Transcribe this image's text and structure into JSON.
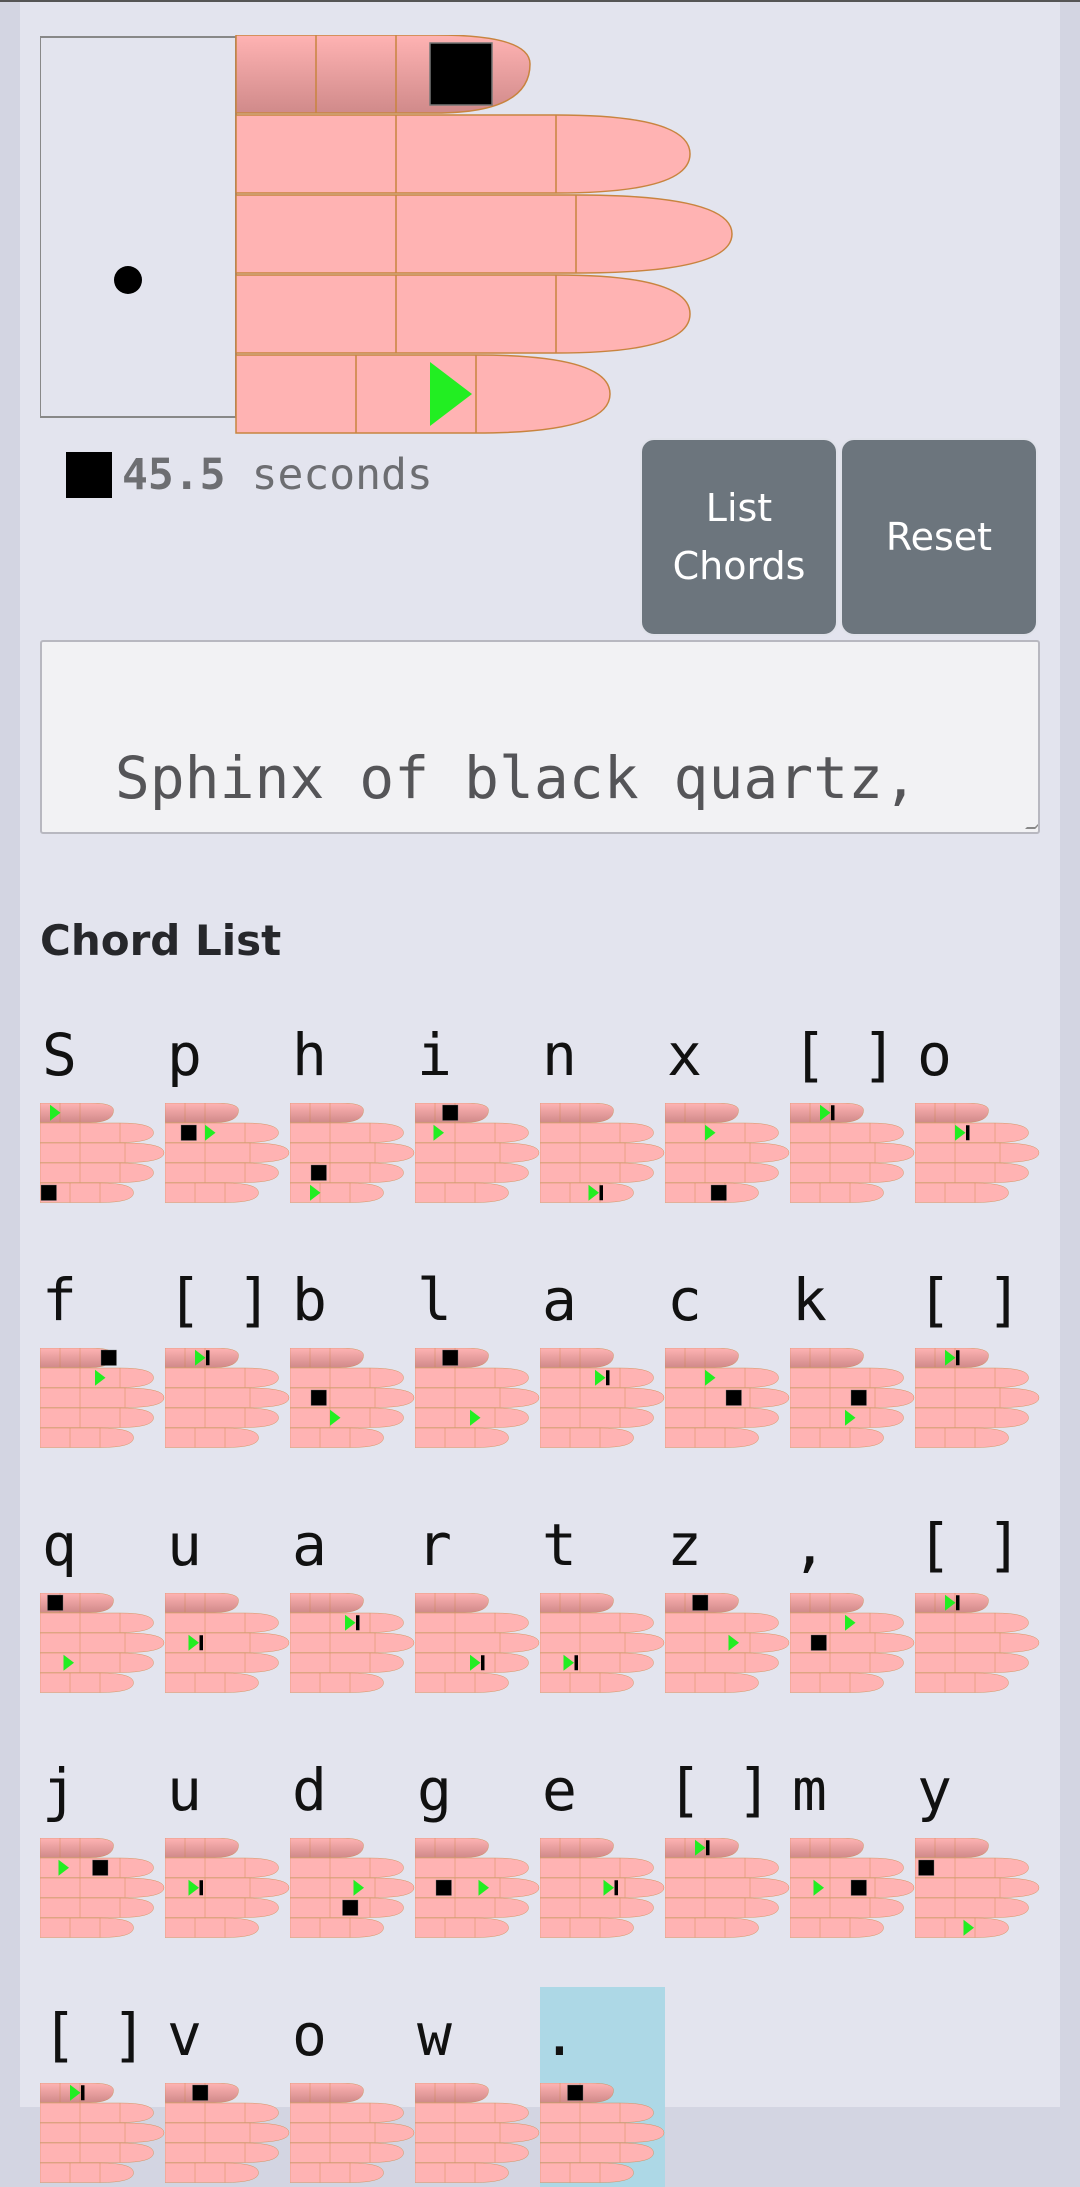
{
  "timer": {
    "value": "45.5",
    "unit": "seconds"
  },
  "buttons": {
    "list_chords": "List Chords",
    "reset": "Reset"
  },
  "text": "Sphinx of black quartz, judge my vow.",
  "chord_list_title": "Chord List",
  "colors": {
    "skin": "#ffb3b3",
    "skin_top": "#d08a8a",
    "outline": "#c8843f",
    "press_square": "#000000",
    "press_arrow": "#22ee22",
    "highlight": "#add8e6"
  },
  "big_hand": {
    "square": [
      "thumb",
      3
    ],
    "arrow": [
      "pinky",
      3
    ],
    "bar": false,
    "palm_dot": true
  },
  "chords": [
    {
      "char": "S",
      "square": [
        "pinky",
        1
      ],
      "arrow": [
        "thumb",
        1
      ]
    },
    {
      "char": "p",
      "square": [
        "index",
        2
      ],
      "arrow": [
        "index",
        3
      ]
    },
    {
      "char": "h",
      "square": [
        "ring",
        2
      ],
      "arrow": [
        "pinky",
        2
      ]
    },
    {
      "char": "i",
      "square": [
        "thumb",
        2
      ],
      "arrow": [
        "index",
        2
      ]
    },
    {
      "char": "n",
      "square": null,
      "arrow": [
        "pinky",
        3
      ],
      "bar": true
    },
    {
      "char": "x",
      "square": [
        "pinky",
        3
      ],
      "arrow": [
        "index",
        3
      ]
    },
    {
      "char": "[ ]",
      "square": null,
      "arrow": [
        "thumb",
        2
      ],
      "bar": true
    },
    {
      "char": "o",
      "square": null,
      "arrow": [
        "index",
        3
      ],
      "bar": true
    },
    {
      "char": "f",
      "square": [
        "thumb",
        4
      ],
      "arrow": [
        "index",
        4
      ]
    },
    {
      "char": "[ ]",
      "square": null,
      "arrow": [
        "thumb",
        2
      ],
      "bar": true
    },
    {
      "char": "b",
      "square": [
        "middle",
        2
      ],
      "arrow": [
        "ring",
        3
      ]
    },
    {
      "char": "l",
      "square": [
        "thumb",
        2
      ],
      "arrow": [
        "ring",
        4
      ]
    },
    {
      "char": "a",
      "square": null,
      "arrow": [
        "index",
        4
      ],
      "bar": true
    },
    {
      "char": "c",
      "square": [
        "middle",
        4
      ],
      "arrow": [
        "index",
        3
      ]
    },
    {
      "char": "k",
      "square": [
        "middle",
        4
      ],
      "arrow": [
        "ring",
        4
      ]
    },
    {
      "char": "[ ]",
      "square": null,
      "arrow": [
        "thumb",
        2
      ],
      "bar": true
    },
    {
      "char": "q",
      "square": [
        "thumb",
        1
      ],
      "arrow": [
        "ring",
        2
      ]
    },
    {
      "char": "u",
      "square": null,
      "arrow": [
        "middle",
        2
      ],
      "bar": true
    },
    {
      "char": "a",
      "square": null,
      "arrow": [
        "index",
        4
      ],
      "bar": true
    },
    {
      "char": "r",
      "square": null,
      "arrow": [
        "ring",
        4
      ],
      "bar": true
    },
    {
      "char": "t",
      "square": null,
      "arrow": [
        "ring",
        2
      ],
      "bar": true
    },
    {
      "char": "z",
      "square": [
        "thumb",
        2
      ],
      "arrow": [
        "middle",
        4
      ]
    },
    {
      "char": ",",
      "square": [
        "middle",
        2
      ],
      "arrow": [
        "index",
        4
      ]
    },
    {
      "char": "[ ]",
      "square": null,
      "arrow": [
        "thumb",
        2
      ],
      "bar": true
    },
    {
      "char": "j",
      "square": [
        "index",
        4
      ],
      "arrow": [
        "index",
        2
      ]
    },
    {
      "char": "u",
      "square": null,
      "arrow": [
        "middle",
        2
      ],
      "bar": true
    },
    {
      "char": "d",
      "square": [
        "ring",
        4
      ],
      "arrow": [
        "middle",
        4
      ]
    },
    {
      "char": "g",
      "square": [
        "middle",
        2
      ],
      "arrow": [
        "middle",
        4
      ]
    },
    {
      "char": "e",
      "square": null,
      "arrow": [
        "middle",
        4
      ],
      "bar": true
    },
    {
      "char": "[ ]",
      "square": null,
      "arrow": [
        "thumb",
        2
      ],
      "bar": true
    },
    {
      "char": "m",
      "square": [
        "middle",
        4
      ],
      "arrow": [
        "middle",
        2
      ]
    },
    {
      "char": "y",
      "square": [
        "index",
        1
      ],
      "arrow": [
        "pinky",
        3
      ]
    },
    {
      "char": "[ ]",
      "square": null,
      "arrow": [
        "thumb",
        2
      ],
      "bar": true
    },
    {
      "char": "v",
      "square": [
        "thumb",
        2
      ],
      "arrow": null
    },
    {
      "char": "o",
      "square": null,
      "arrow": null
    },
    {
      "char": "w",
      "square": null,
      "arrow": null
    },
    {
      "char": ".",
      "square": [
        "thumb",
        2
      ],
      "arrow": null,
      "highlighted": true
    }
  ]
}
